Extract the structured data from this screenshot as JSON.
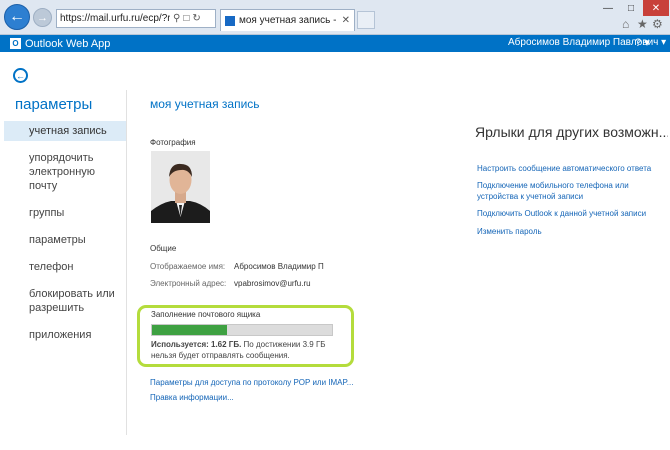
{
  "browser": {
    "url": "https://mail.urfu.ru/ecp/?rfr=owa",
    "tab_title": "моя учетная запись - Outl...",
    "back_icon": "arrow-left-icon",
    "forward_icon": "arrow-right-icon"
  },
  "owa": {
    "app_title": "Outlook Web App",
    "user_name": "Абросимов Владимир Павлович",
    "help_label": "?",
    "brand_color": "#0072c6"
  },
  "sidebar": {
    "title": "параметры",
    "items": [
      {
        "label": "учетная запись",
        "active": true
      },
      {
        "label": "упорядочить электронную почту",
        "active": false
      },
      {
        "label": "группы",
        "active": false
      },
      {
        "label": "параметры",
        "active": false
      },
      {
        "label": "телефон",
        "active": false
      },
      {
        "label": "блокировать или разрешить",
        "active": false
      },
      {
        "label": "приложения",
        "active": false
      }
    ]
  },
  "account": {
    "title": "моя учетная запись",
    "photo_label": "Фотография",
    "general_label": "Общие",
    "display_name_label": "Отображаемое имя:",
    "display_name_value": "Абросимов Владимир П",
    "email_label": "Электронный адрес:",
    "email_value": "vpabrosimov@urfu.ru"
  },
  "quota": {
    "title": "Заполнение почтового ящика",
    "used_label": "Используется: 1.62 ГБ.",
    "note": "По достижении 3.9 ГБ нельзя будет отправлять сообщения.",
    "used_fraction": 0.415,
    "highlight_color": "#b4dc3c",
    "fill_color": "#3ea142"
  },
  "links": {
    "pop_imap": "Параметры для доступа по протоколу POP или IMAP...",
    "edit_info": "Правка информации..."
  },
  "shortcuts": {
    "title": "Ярлыки для других возможн...",
    "items": [
      "Настроить сообщение автоматического ответа",
      "Подключение мобильного телефона или устройства к учетной записи",
      "Подключить Outlook к данной учетной записи",
      "Изменить пароль"
    ]
  }
}
